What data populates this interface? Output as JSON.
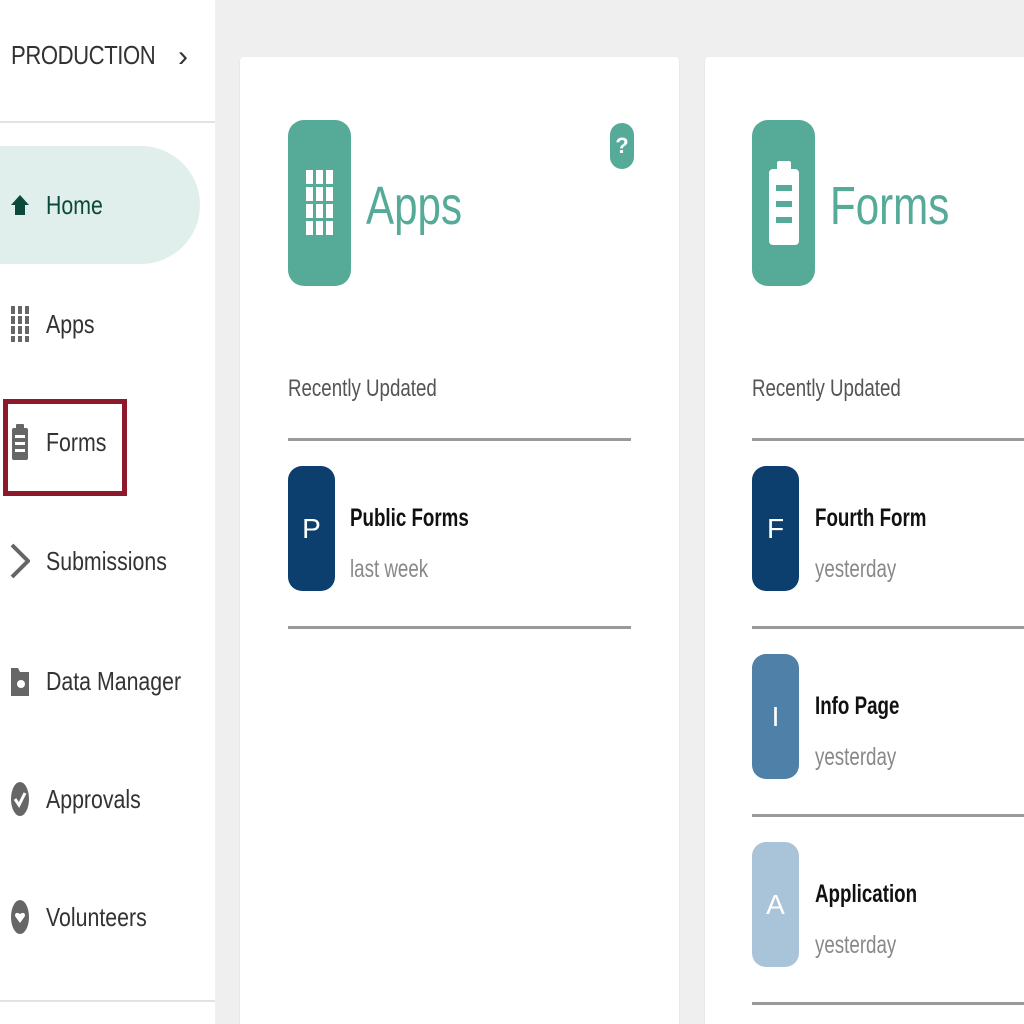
{
  "sidebar": {
    "environment": "PRODUCTION",
    "chevron": "›",
    "items": [
      {
        "label": "Home",
        "icon": "home-icon",
        "active": true
      },
      {
        "label": "Apps",
        "icon": "apps-grid-icon"
      },
      {
        "label": "Forms",
        "icon": "clipboard-icon",
        "highlighted": true
      },
      {
        "label": "Submissions",
        "icon": "chevron-right-icon"
      },
      {
        "label": "Data Manager",
        "icon": "folder-star-icon"
      },
      {
        "label": "Approvals",
        "icon": "check-badge-icon"
      },
      {
        "label": "Volunteers",
        "icon": "heart-badge-icon"
      }
    ]
  },
  "apps_card": {
    "title": "Apps",
    "help": "?",
    "section_label": "Recently Updated",
    "items": [
      {
        "initial": "P",
        "name": "Public Forms",
        "time": "last week",
        "color": "#0d3f6e"
      }
    ]
  },
  "forms_card": {
    "title": "Forms",
    "section_label": "Recently Updated",
    "items": [
      {
        "initial": "F",
        "name": "Fourth Form",
        "time": "yesterday",
        "color": "#0d3f6e"
      },
      {
        "initial": "I",
        "name": "Info Page",
        "time": "yesterday",
        "color": "#4f80a8"
      },
      {
        "initial": "A",
        "name": "Application",
        "time": "yesterday",
        "color": "#a9c3d8"
      }
    ]
  },
  "colors": {
    "accent": "#55aa98",
    "active_nav_bg": "#e0efeb",
    "highlight_border": "#8c1a2c"
  }
}
